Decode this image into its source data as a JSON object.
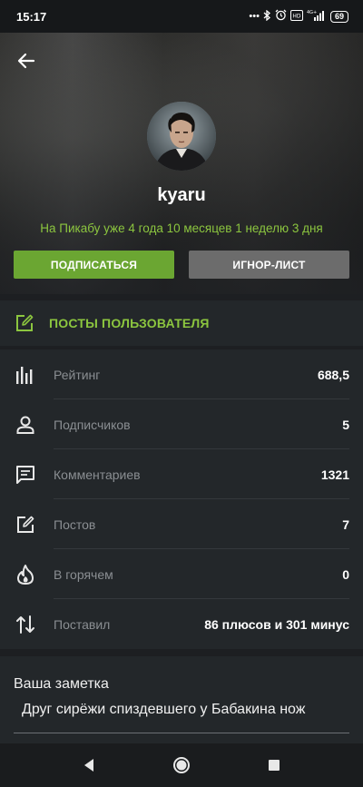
{
  "status_bar": {
    "time": "15:17",
    "icons": [
      "more-dots-icon",
      "bluetooth-icon",
      "alarm-icon",
      "volte-icon",
      "signal-4g-icon"
    ],
    "network": "4G+",
    "battery": "69"
  },
  "header": {
    "username": "kyaru",
    "tenure": "На Пикабу уже 4 года 10 месяцев 1 неделю 3 дня",
    "subscribe_label": "ПОДПИСАТЬСЯ",
    "ignore_label": "ИГНОР-ЛИСТ"
  },
  "posts_link": {
    "label": "ПОСТЫ ПОЛЬЗОВАТЕЛЯ",
    "icon": "edit-icon"
  },
  "stats": [
    {
      "icon": "rating-bars-icon",
      "label": "Рейтинг",
      "value": "688,5"
    },
    {
      "icon": "person-icon",
      "label": "Подписчиков",
      "value": "5"
    },
    {
      "icon": "comment-icon",
      "label": "Комментариев",
      "value": "1321"
    },
    {
      "icon": "edit-icon",
      "label": "Постов",
      "value": "7"
    },
    {
      "icon": "fire-icon",
      "label": "В горячем",
      "value": "0"
    },
    {
      "icon": "sort-arrows-icon",
      "label": "Поставил",
      "value": "86 плюсов и 301 минус"
    }
  ],
  "note": {
    "title": "Ваша заметка",
    "text": "Друг сирёжи спиздевшего у Бабакина нож"
  },
  "colors": {
    "accent_green": "#8cc63f",
    "button_green": "#6ba632",
    "button_gray": "#6c6c6c",
    "card_bg": "#23272a",
    "page_bg": "#1d1f22"
  }
}
